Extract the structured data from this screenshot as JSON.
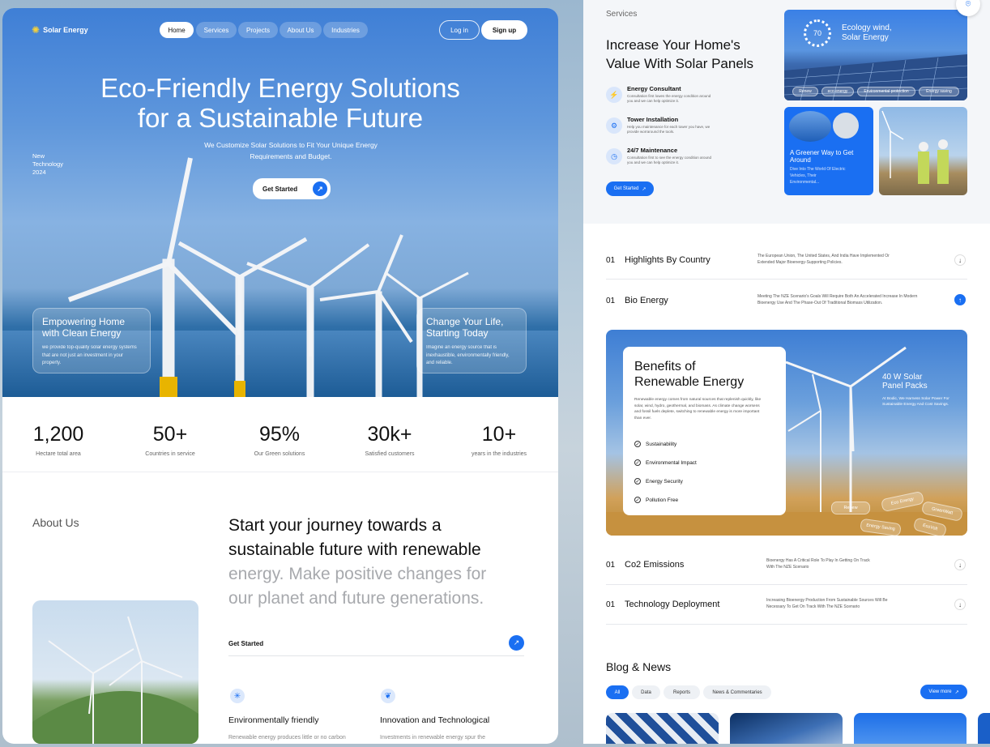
{
  "left": {
    "brand": "Solar Energy",
    "nav": [
      "Home",
      "Services",
      "Projects",
      "About Us",
      "Industries"
    ],
    "login": "Log in",
    "signup": "Sign up",
    "hero_title_1": "Eco-Friendly Energy Solutions",
    "hero_title_2": "for a Sustainable Future",
    "hero_sub_1": "We Customize Solar Solutions to Fit Your Unique Energy",
    "hero_sub_2": "Requirements and Budget.",
    "new_tech": [
      "New",
      "Technology",
      "2024"
    ],
    "get_started": "Get Started",
    "card_left_title": "Empowering Home with Clean Energy",
    "card_left_text": "we provide top-quality solar energy systems that are not just an investment in your property.",
    "card_right_title": "Change Your Life, Starting Today",
    "card_right_text": "Imagine an energy source that is inexhaustible, environmentally friendly, and reliable.",
    "stats": [
      {
        "n": "1,200",
        "l": "Hectare total area"
      },
      {
        "n": "50+",
        "l": "Countries in service"
      },
      {
        "n": "95%",
        "l": "Our Green solutions"
      },
      {
        "n": "30k+",
        "l": "Satisfied customers"
      },
      {
        "n": "10+",
        "l": "years in the industries"
      }
    ],
    "about_label": "About Us",
    "about_heading_dark_1": "Start your journey towards a",
    "about_heading_dark_2": "sustainable future with renewable",
    "about_heading_light_1": "energy. Make positive changes for",
    "about_heading_light_2": "our planet and future generations.",
    "about_cta": "Get Started",
    "feature_1_title": "Environmentally friendly",
    "feature_1_text": "Renewable energy produces little or no carbon",
    "feature_2_title": "Innovation and Technological",
    "feature_2_text": "Investments in renewable energy spur the"
  },
  "right": {
    "services_label": "Services",
    "services_title_1": "Increase Your Home's",
    "services_title_2": "Value With Solar Panels",
    "services": [
      {
        "t": "Energy Consultant",
        "d": "Consultation first lowes the energy condition around you and we can help optimize it."
      },
      {
        "t": "Tower Installation",
        "d": "Help you maintenance for each tower you have, we provide worraround the tools."
      },
      {
        "t": "24/7 Maintenance",
        "d": "Consultation first to see the energy condition around you and we can help optimize it."
      }
    ],
    "services_cta": "Get Started",
    "eco_badge": "70",
    "eco_title_1": "Ecology wind,",
    "eco_title_2": "Solar Energy",
    "eco_tags": [
      "Renew",
      "eco energy",
      "Environmental protection",
      "Energy saving"
    ],
    "greener_title": "A Greener Way to Get Around",
    "greener_text": "Dive Into The World Of Electric Vehicles, Their Environmental...",
    "accordion": [
      {
        "num": "01",
        "title": "Highlights By Country",
        "desc": "The European Union, The United States, And India Have Implemented Or Extended Major Bioenergy-Supporting Policies."
      },
      {
        "num": "01",
        "title": "Bio Energy",
        "desc": "Meeting The NZE Scenario's Goals Will Require Both An Accelerated Increase In Modern Bioenergy Use And The Phase-Out Of Traditional Biomass Utilization."
      }
    ],
    "benefits_title_1": "Benefits of",
    "benefits_title_2": "Renewable Energy",
    "benefits_text": "Renewable energy comes from natural sources that replenish quickly, like solar, wind, hydro, geothermal, and biomass. As climate change worsens and fossil fuels deplete, switching to renewable energy is more important than ever.",
    "benefits_list": [
      "Sustainability",
      "Environmental Impact",
      "Energy Security",
      "Pollution Free"
    ],
    "panel_title_1": "40 W Solar",
    "panel_title_2": "Panel Packs",
    "panel_text": "At Bodic, We Harness Solar Power For Sustainable Energy And Cost Savings.",
    "float_tags": [
      "Renew",
      "Eco Energy",
      "GreenWatt",
      "Energy Saving",
      "EcoVolt"
    ],
    "accordion2": [
      {
        "num": "01",
        "title": "Co2 Emissions",
        "desc": "Bioenergy Has A Critical Role To Play In Getting On Track With The NZE Scenario"
      },
      {
        "num": "01",
        "title": "Technology Deployment",
        "desc": "Increasing Bioenergy Production From Sustainable Sources Will Be Necessary To Get On Track With The NZE Scenario"
      }
    ],
    "blog_title": "Blog & News",
    "blog_tabs": [
      "All",
      "Data",
      "Reports",
      "News & Commentaries"
    ],
    "view_more": "View more"
  },
  "colors": {
    "accent": "#1a6ff2",
    "hero_top": "#3f7fd6",
    "text": "#111111"
  }
}
